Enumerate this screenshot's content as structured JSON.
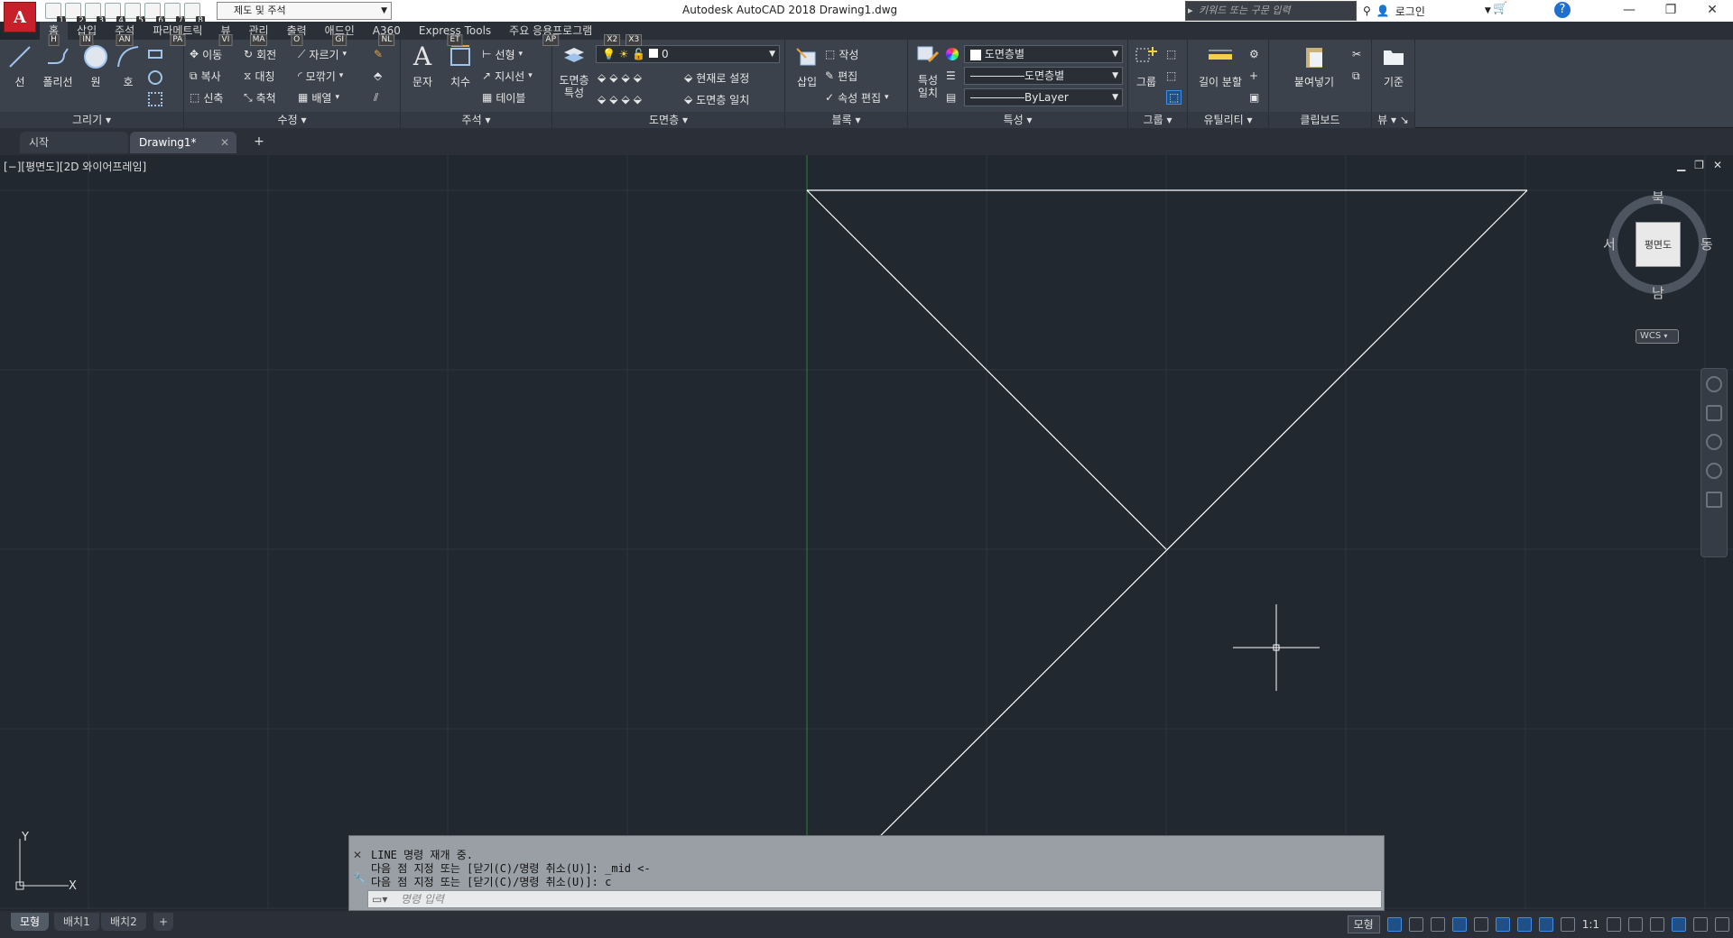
{
  "titlebar": {
    "app_letter": "A",
    "workspace": "제도 및 주석",
    "title": "Autodesk AutoCAD 2018    Drawing1.dwg",
    "search_placeholder": "키워드 또는 구문 입력",
    "login": "로그인",
    "qat_keys": [
      "1",
      "2",
      "3",
      "4",
      "5",
      "6",
      "7",
      "8"
    ]
  },
  "ribbon_tabs": [
    {
      "label": "홈",
      "key": "H"
    },
    {
      "label": "삽입",
      "key": "IN"
    },
    {
      "label": "주석",
      "key": "AN"
    },
    {
      "label": "파라메트릭",
      "key": "PA"
    },
    {
      "label": "뷰",
      "key": "VI"
    },
    {
      "label": "관리",
      "key": "MA"
    },
    {
      "label": "출력",
      "key": "O"
    },
    {
      "label": "애드인",
      "key": "GI"
    },
    {
      "label": "A360",
      "key": "NL"
    },
    {
      "label": "Express Tools",
      "key": "ET"
    },
    {
      "label": "주요 응용프로그램",
      "key": "AP"
    },
    {
      "label": "",
      "key": "X2"
    },
    {
      "label": "",
      "key": "X3"
    }
  ],
  "panels": {
    "draw": {
      "title": "그리기",
      "line": "선",
      "polyline": "폴리선",
      "circle": "원",
      "arc": "호"
    },
    "modify": {
      "title": "수정",
      "move": "이동",
      "rotate": "회전",
      "trim": "자르기",
      "copy": "복사",
      "mirror": "대칭",
      "fillet": "모깎기",
      "stretch": "신축",
      "scale": "축척",
      "array": "배열"
    },
    "annotation": {
      "title": "주석",
      "text": "문자",
      "dimension": "치수",
      "linear": "선형",
      "leader": "지시선",
      "table": "테이블"
    },
    "layers": {
      "title": "도면층",
      "props": "도면층\n특성",
      "layer_value": "0",
      "make_current": "현재로 설정",
      "match_layer": "도면층 일치"
    },
    "block": {
      "title": "블록",
      "insert": "삽입",
      "create": "작성",
      "edit": "편집",
      "attr_edit": "속성 편집"
    },
    "properties": {
      "title": "특성",
      "match": "특성\n일치",
      "color": "도면층별",
      "linetype": "도면층별",
      "lineweight": "ByLayer"
    },
    "groups": {
      "title": "그룹",
      "group": "그룹"
    },
    "utilities": {
      "title": "유틸리티",
      "measure": "길이 분할"
    },
    "clipboard": {
      "title": "클립보드",
      "paste": "붙여넣기"
    },
    "view": {
      "title": "뷰",
      "base": "기준"
    }
  },
  "file_tabs": [
    {
      "label": "시작",
      "active": false
    },
    {
      "label": "Drawing1*",
      "active": true
    }
  ],
  "viewport": {
    "label": "[−][평면도][2D 와이어프레임]",
    "viewcube": {
      "north": "북",
      "south": "남",
      "east": "동",
      "west": "서",
      "face": "평면도"
    },
    "wcs": "WCS",
    "ucs_x": "X",
    "ucs_y": "Y"
  },
  "command": {
    "history": [
      "LINE 명령 재개 중.",
      "다음 점 지정 또는 [닫기(C)/명령 취소(U)]: _mid <-",
      "다음 점 지정 또는 [닫기(C)/명령 취소(U)]: c"
    ],
    "placeholder": "명령 입력"
  },
  "status": {
    "layout_tabs": [
      {
        "label": "모형",
        "active": true
      },
      {
        "label": "배치1",
        "active": false
      },
      {
        "label": "배치2",
        "active": false
      }
    ],
    "model": "모형",
    "scale": "1:1"
  },
  "colors": {
    "canvas_bg": "#212830",
    "line": "#ffffff",
    "y_axis": "#2f7d3a",
    "accent": "#3d8ee6"
  }
}
